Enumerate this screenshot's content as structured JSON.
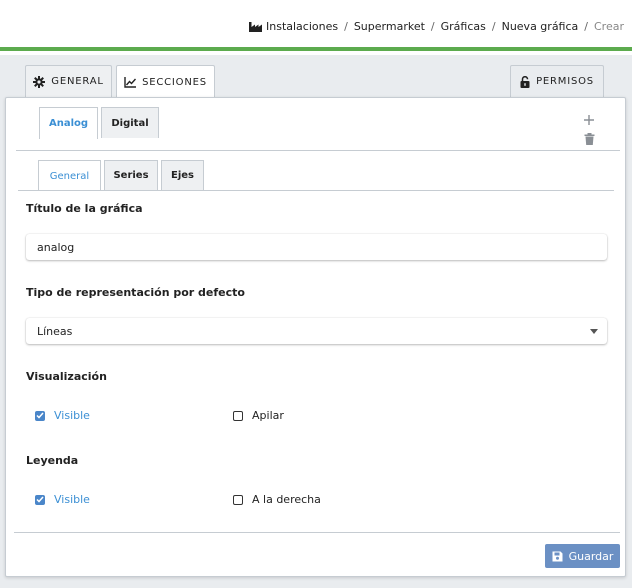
{
  "breadcrumb": {
    "items": [
      "Instalaciones",
      "Supermarket",
      "Gráficas",
      "Nueva gráfica"
    ],
    "current": "Crear",
    "separator": "/"
  },
  "tabs": {
    "general": "GENERAL",
    "secciones": "SECCIONES",
    "permisos": "PERMISOS"
  },
  "sections": {
    "analog": "Analog",
    "digital": "Digital"
  },
  "inner_tabs": {
    "general": "General",
    "series": "Series",
    "ejes": "Ejes"
  },
  "form": {
    "title_label": "Título de la gráfica",
    "title_value": "analog",
    "type_label": "Tipo de representación por defecto",
    "type_value": "Líneas",
    "visualization_label": "Visualización",
    "visualization_visible": "Visible",
    "visualization_visible_checked": true,
    "visualization_stack": "Apilar",
    "visualization_stack_checked": false,
    "legend_label": "Leyenda",
    "legend_visible": "Visible",
    "legend_visible_checked": true,
    "legend_right": "A la derecha",
    "legend_right_checked": false
  },
  "actions": {
    "save": "Guardar"
  },
  "colors": {
    "accent_green": "#5cab4e",
    "active_tab_text": "#3b8fd4",
    "checkbox": "#4a86c9",
    "save_button": "#6b90c4"
  }
}
